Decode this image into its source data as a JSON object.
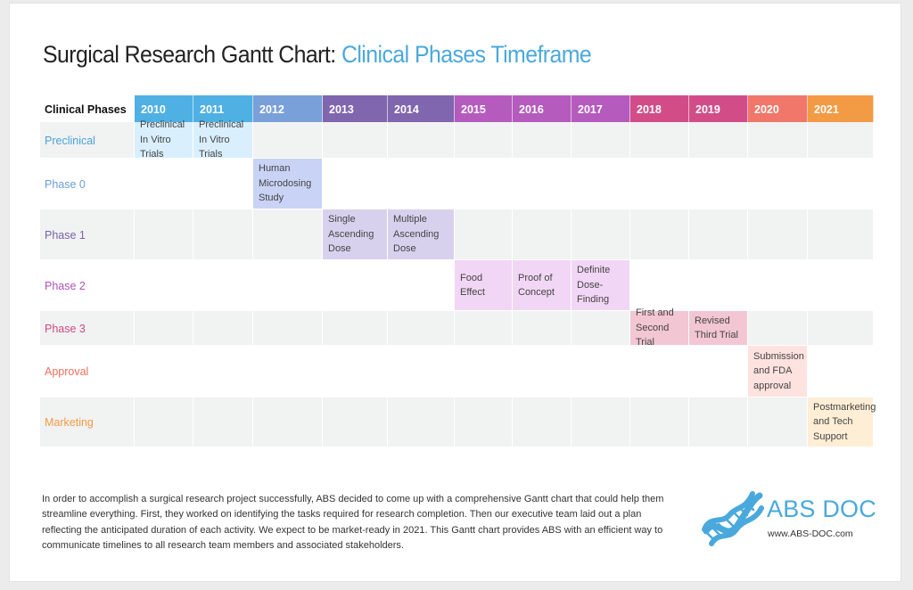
{
  "title": {
    "main": "Surgical Research Gantt Chart: ",
    "accent": "Clinical Phases Timeframe"
  },
  "chart_data": {
    "type": "table",
    "title": "Surgical Research Gantt Chart: Clinical Phases Timeframe",
    "header_label": "Clinical Phases",
    "years": [
      "2010",
      "2011",
      "2012",
      "2013",
      "2014",
      "2015",
      "2016",
      "2017",
      "2018",
      "2019",
      "2020",
      "2021"
    ],
    "year_colors": [
      "#4fb0e3",
      "#4fb0e3",
      "#7aa0d9",
      "#7f66ae",
      "#7f66ae",
      "#b55bbd",
      "#b55bbd",
      "#b55bbd",
      "#d24d88",
      "#d24d88",
      "#f07769",
      "#f39a45"
    ],
    "phases": [
      {
        "name": "Preclinical",
        "color": "#4aa3d6",
        "task_bg": "#d9effd",
        "tasks": [
          {
            "year": "2010",
            "label": "Preclinical In Vitro Trials"
          },
          {
            "year": "2011",
            "label": "Preclinical In Vitro Trials"
          }
        ]
      },
      {
        "name": "Phase 0",
        "color": "#6a9fd3",
        "task_bg": "#c9d3f5",
        "tasks": [
          {
            "year": "2012",
            "label": "Human Microdosing Study"
          }
        ]
      },
      {
        "name": "Phase 1",
        "color": "#7a62ab",
        "task_bg": "#d8d1ee",
        "tasks": [
          {
            "year": "2013",
            "label": "Single Ascending Dose"
          },
          {
            "year": "2014",
            "label": "Multiple Ascending Dose"
          }
        ]
      },
      {
        "name": "Phase 2",
        "color": "#b052bd",
        "task_bg": "#f2d6f5",
        "tasks": [
          {
            "year": "2015",
            "label": "Food Effect"
          },
          {
            "year": "2016",
            "label": "Proof of Concept"
          },
          {
            "year": "2017",
            "label": "Definite Dose-Finding"
          }
        ]
      },
      {
        "name": "Phase 3",
        "color": "#cf4a84",
        "task_bg": "#f2c6d3",
        "tasks": [
          {
            "year": "2018",
            "label": "First and Second Trial"
          },
          {
            "year": "2019",
            "label": "Revised Third Trial"
          }
        ]
      },
      {
        "name": "Approval",
        "color": "#ee6e60",
        "task_bg": "#fde2df",
        "tasks": [
          {
            "year": "2020",
            "label": "Submission and FDA approval"
          }
        ]
      },
      {
        "name": "Marketing",
        "color": "#f09a48",
        "task_bg": "#feeed5",
        "tasks": [
          {
            "year": "2021",
            "label": "Postmarketing and Tech Support"
          }
        ]
      }
    ]
  },
  "description": "In order to accomplish a surgical research project successfully, ABS decided to come up with a comprehensive Gantt chart that could help them streamline everything. First, they worked on identifying the tasks required for research completion. Then our executive team laid out a plan reflecting the anticipated duration of each activity. We expect to be market-ready in 2021. This Gantt chart provides ABS with an efficient way to communicate timelines to all research team members and associated stakeholders.",
  "logo": {
    "name": "ABS DOC",
    "url": "www.ABS-DOC.com",
    "icon": "dna-icon",
    "color": "#4aa9dc"
  }
}
